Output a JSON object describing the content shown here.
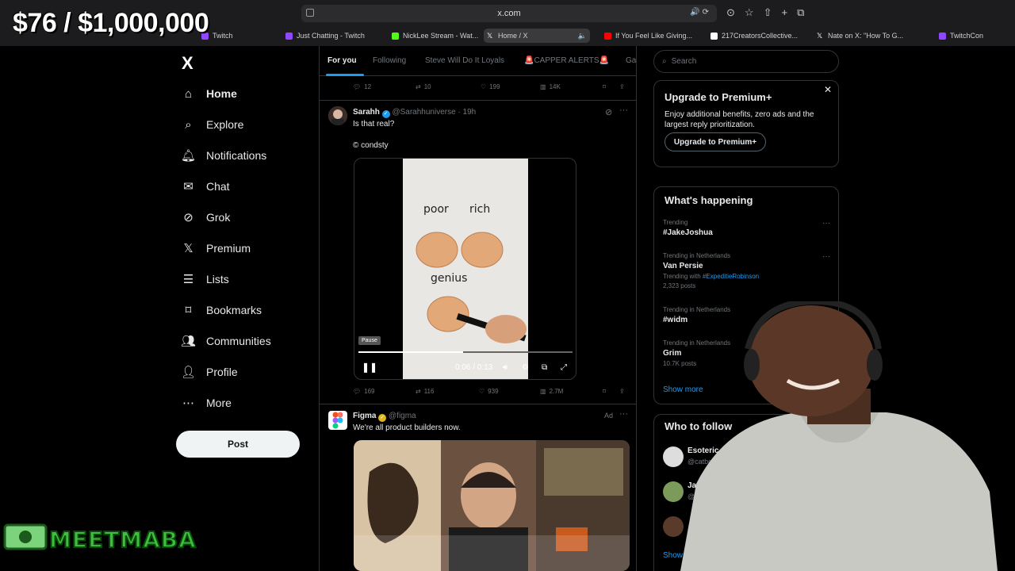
{
  "browser": {
    "url": "x.com",
    "tabs": [
      {
        "label": "Twitch",
        "color": "#9146ff"
      },
      {
        "label": "Just Chatting - Twitch",
        "color": "#9146ff"
      },
      {
        "label": "NickLee Stream - Wat...",
        "color": "#53fc18"
      },
      {
        "label": "Home / X",
        "color": "#ffffff"
      },
      {
        "label": "If You Feel Like Giving...",
        "color": "#ff0000"
      },
      {
        "label": "217CreatorsCollective...",
        "color": "#ffffff"
      },
      {
        "label": "Nate on X: \"How To G...",
        "color": "#ffffff"
      },
      {
        "label": "TwitchCon",
        "color": "#9146ff"
      }
    ]
  },
  "overlay": {
    "money": "$76 / $1,000,000",
    "brand": "MEETMABA"
  },
  "sidebar": {
    "logo": "X",
    "items": [
      {
        "label": "Home",
        "icon": "home-icon"
      },
      {
        "label": "Explore",
        "icon": "search-icon"
      },
      {
        "label": "Notifications",
        "icon": "bell-icon"
      },
      {
        "label": "Chat",
        "icon": "mail-icon"
      },
      {
        "label": "Grok",
        "icon": "grok-icon"
      },
      {
        "label": "Premium",
        "icon": "x-icon"
      },
      {
        "label": "Lists",
        "icon": "list-icon"
      },
      {
        "label": "Bookmarks",
        "icon": "bookmark-icon"
      },
      {
        "label": "Communities",
        "icon": "people-icon"
      },
      {
        "label": "Profile",
        "icon": "person-icon"
      },
      {
        "label": "More",
        "icon": "more-circle-icon"
      }
    ],
    "post_label": "Post"
  },
  "feed": {
    "tabs": [
      "For you",
      "Following",
      "Steve Will Do It Loyals",
      "🚨CAPPER ALERTS🚨",
      "Ga"
    ],
    "prev_actions": {
      "replies": "12",
      "reposts": "10",
      "likes": "199",
      "views": "14K"
    },
    "tweet1": {
      "name": "Sarahh",
      "handle": "@Sarahhuniverse · 19h",
      "text": "Is that real?",
      "credit": "© condsty",
      "video": {
        "labels": [
          "poor",
          "rich",
          "genius"
        ],
        "tooltip": "Pause",
        "time": "0:06 / 0:13",
        "progress": 0.49
      },
      "actions": {
        "replies": "169",
        "reposts": "116",
        "likes": "939",
        "views": "2.7M"
      }
    },
    "tweet2": {
      "name": "Figma",
      "handle": "@figma",
      "text": "We're all product builders now.",
      "ad_label": "Ad"
    }
  },
  "right": {
    "search_placeholder": "Search",
    "premium": {
      "title": "Upgrade to Premium+",
      "desc": "Enjoy additional benefits, zero ads and the largest reply prioritization.",
      "button": "Upgrade to Premium+"
    },
    "happening": {
      "title": "What's happening",
      "trends": [
        {
          "context": "Trending",
          "topic": "#JakeJoshua"
        },
        {
          "context": "Trending in Netherlands",
          "topic": "Van Persie",
          "with_prefix": "Trending with",
          "with_tag": "#ExpeditieRobinson",
          "count": "2,323 posts"
        },
        {
          "context": "Trending in Netherlands",
          "topic": "#widm"
        },
        {
          "context": "Trending in Netherlands",
          "topic": "Grim",
          "count": "10.7K posts"
        }
      ],
      "show_more": "Show more"
    },
    "follow": {
      "title": "Who to follow",
      "accounts": [
        {
          "name": "Esoteric Catboy",
          "handle": "@catboyau"
        },
        {
          "name": "Jas",
          "handle": "@"
        }
      ],
      "show_more": "Show"
    }
  }
}
